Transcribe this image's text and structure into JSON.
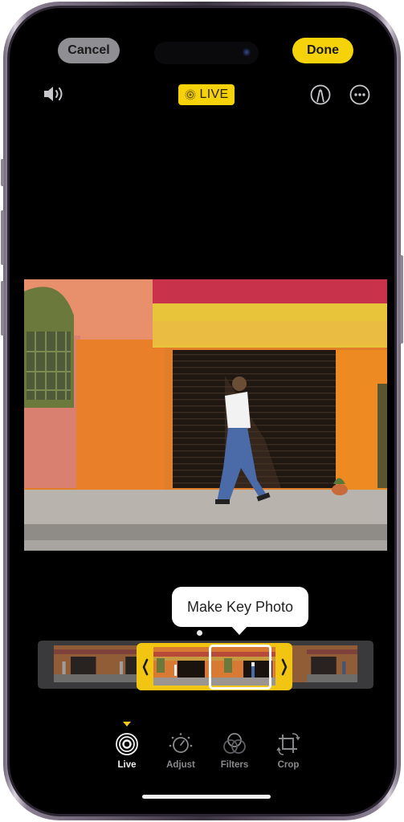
{
  "header": {
    "cancel_label": "Cancel",
    "done_label": "Done",
    "live_badge_label": "LIVE",
    "sound_icon": "speaker-icon",
    "markup_icon": "markup-pen-icon",
    "more_icon": "ellipsis-icon"
  },
  "photo": {
    "description": "Person in white shirt and blue jeans walking past orange wall with dark roll-up shutter and yellow awning"
  },
  "key_photo": {
    "tooltip_label": "Make Key Photo"
  },
  "frame_strip": {
    "left_handle_icon": "chevron-left-icon",
    "right_handle_icon": "chevron-right-icon"
  },
  "toolbar": {
    "active": "Live",
    "tools": [
      {
        "label": "Live",
        "icon": "live-photo-icon"
      },
      {
        "label": "Adjust",
        "icon": "adjust-dial-icon"
      },
      {
        "label": "Filters",
        "icon": "filters-icon"
      },
      {
        "label": "Crop",
        "icon": "crop-rotate-icon"
      }
    ]
  },
  "colors": {
    "accent_yellow": "#f5d20a",
    "background": "#000000",
    "cancel_button": "#8f8f93"
  }
}
